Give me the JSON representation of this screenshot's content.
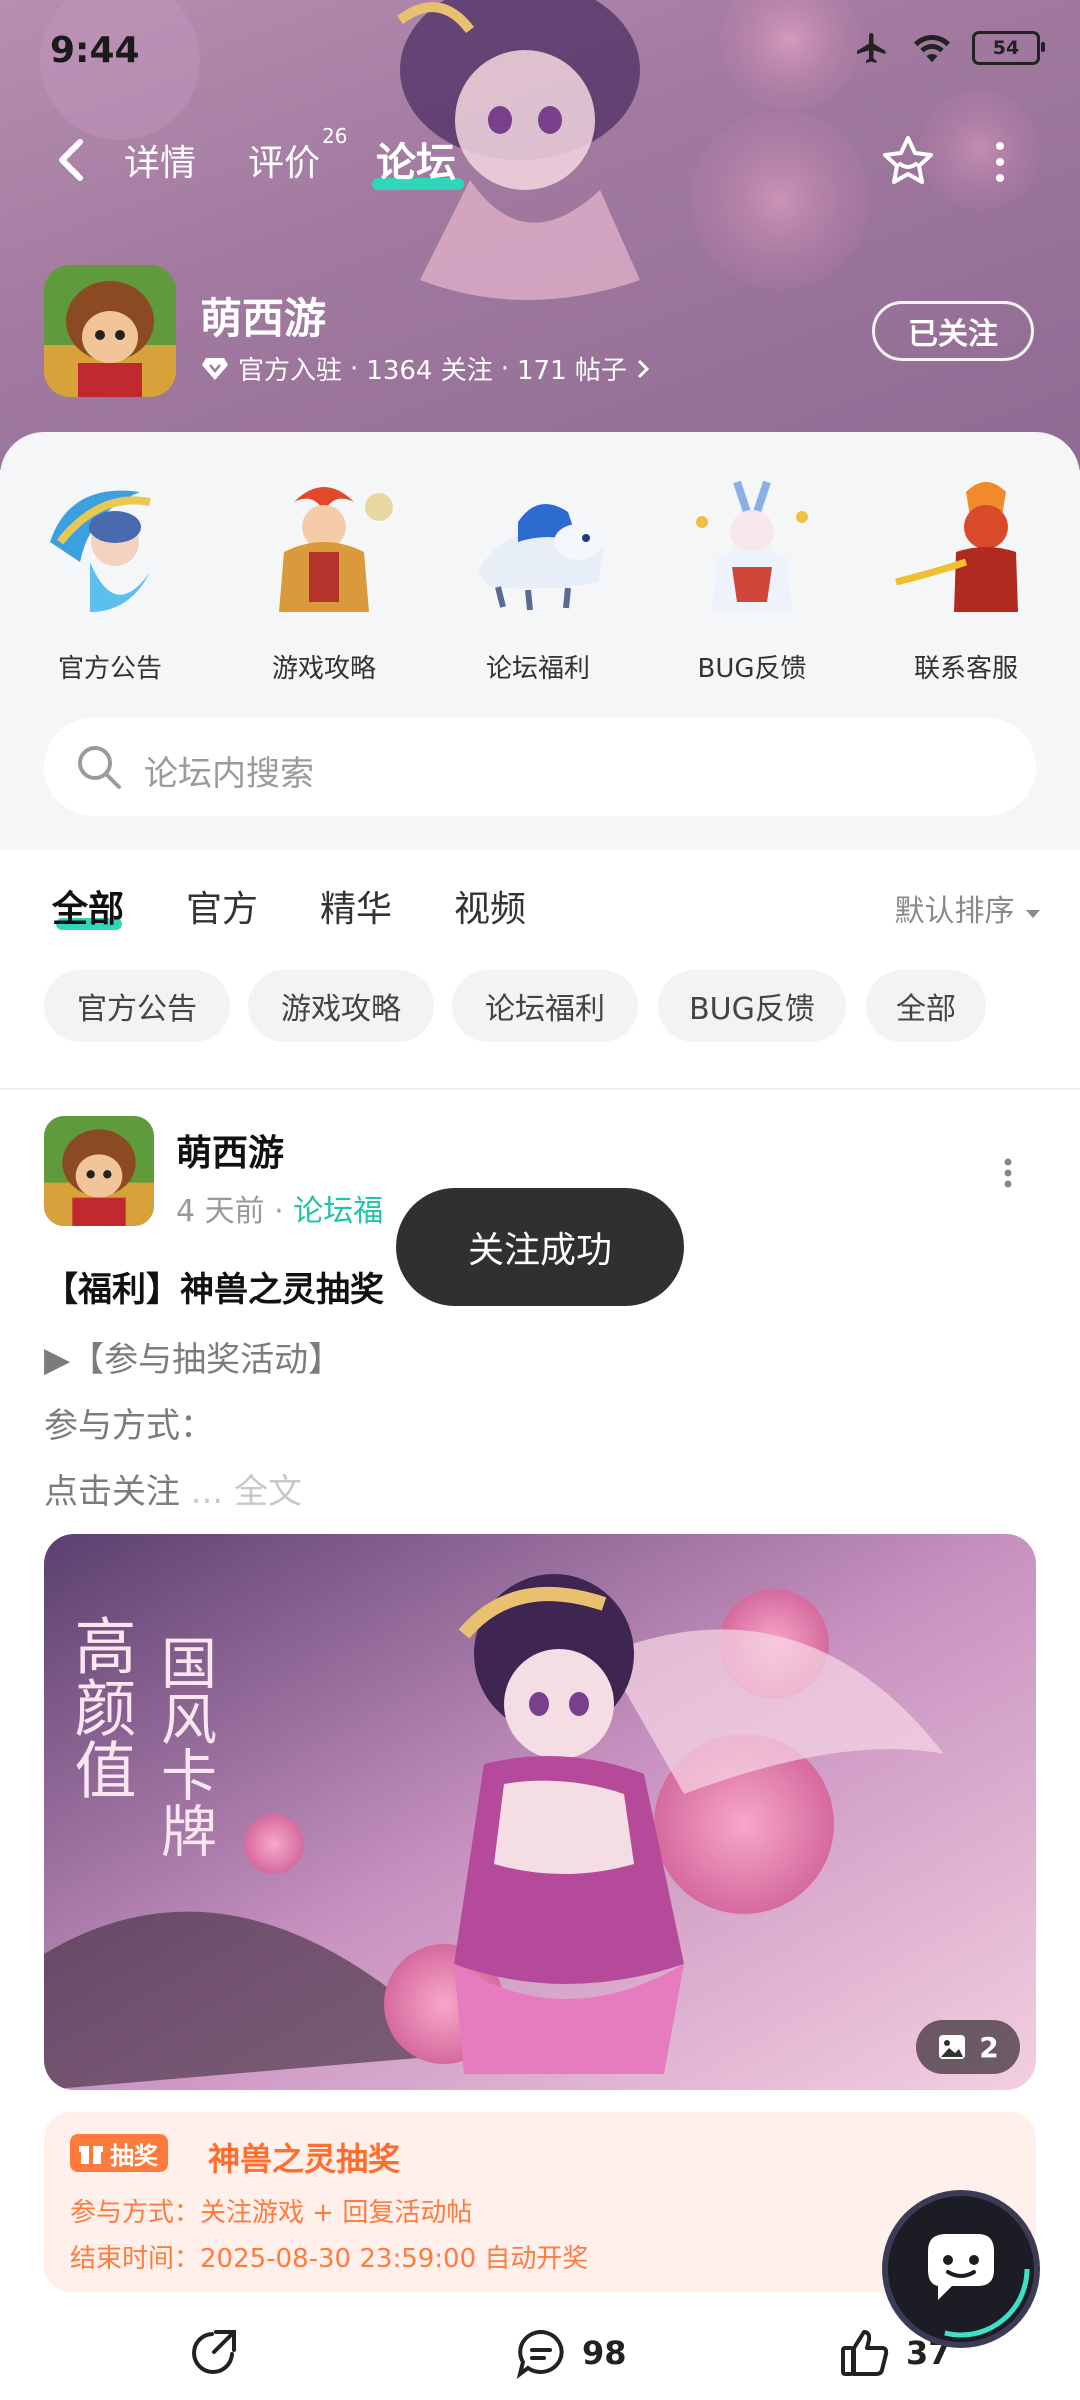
{
  "status_bar": {
    "time": "9:44",
    "battery": "54"
  },
  "nav": {
    "tabs": [
      {
        "label": "详情"
      },
      {
        "label": "评价",
        "badge": "26"
      },
      {
        "label": "论坛"
      }
    ],
    "active_tab": "论坛"
  },
  "game": {
    "name": "萌西游",
    "verified_label": "官方入驻",
    "followers": "1364 关注",
    "posts": "171 帖子",
    "follow_button": "已关注"
  },
  "categories": [
    {
      "label": "官方公告"
    },
    {
      "label": "游戏攻略"
    },
    {
      "label": "论坛福利"
    },
    {
      "label": "BUG反馈"
    },
    {
      "label": "联系客服"
    }
  ],
  "search": {
    "placeholder": "论坛内搜索"
  },
  "filter_tabs": [
    {
      "label": "全部"
    },
    {
      "label": "官方"
    },
    {
      "label": "精华"
    },
    {
      "label": "视频"
    }
  ],
  "sort": {
    "label": "默认排序"
  },
  "chips": [
    {
      "label": "官方公告"
    },
    {
      "label": "游戏攻略"
    },
    {
      "label": "论坛福利"
    },
    {
      "label": "BUG反馈"
    },
    {
      "label": "全部"
    }
  ],
  "post": {
    "author": "萌西游",
    "time": "4 天前",
    "tag": "论坛福",
    "title": "【福利】神兽之灵抽奖",
    "line1": "▶【参与抽奖活动】",
    "line2": "参与方式：",
    "line3": "点击关注",
    "more_ellipsis": " ... ",
    "more_label": "全文",
    "image_overlay_text1": "高颜值",
    "image_overlay_text2": "国风卡牌",
    "image_count": "2",
    "lottery": {
      "badge": "抽奖",
      "title": "神兽之灵抽奖",
      "method": "参与方式：关注游戏 + 回复活动帖",
      "end_time": "结束时间：2025-08-30 23:59:00 自动开奖"
    },
    "comments": "98",
    "likes": "37"
  },
  "toast": {
    "text": "关注成功"
  },
  "colors": {
    "accent": "#2fd6b8",
    "lottery": "#ff6e2c",
    "hero": "#a27aa0"
  }
}
